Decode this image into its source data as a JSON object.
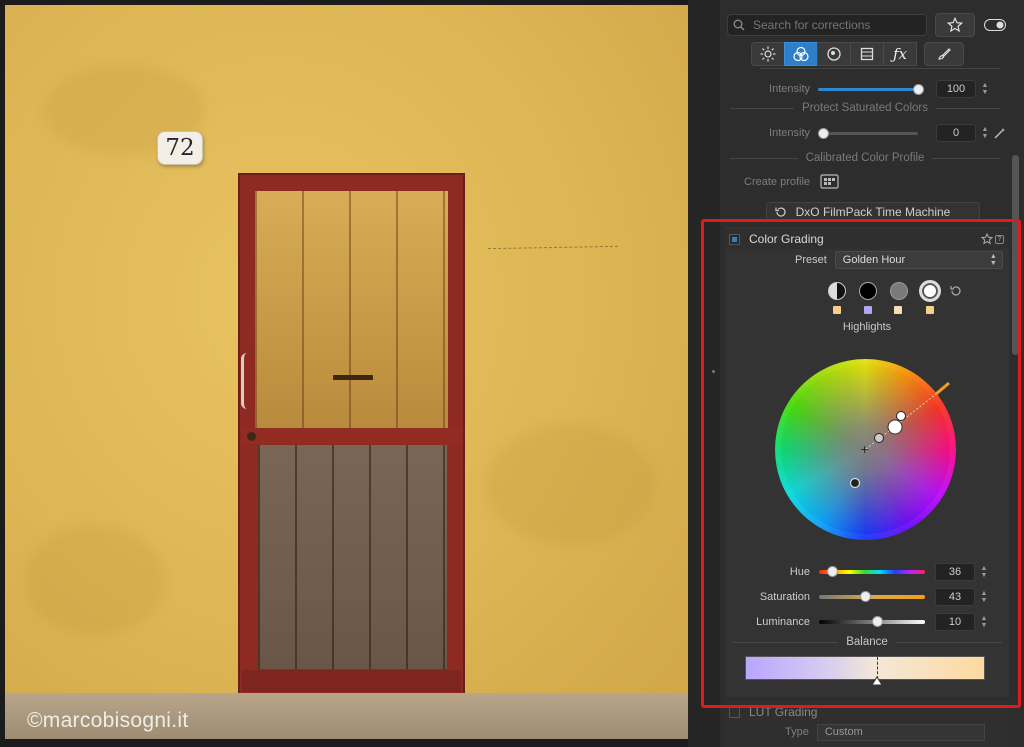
{
  "photo": {
    "house_number": "72",
    "watermark": "©marcobisogni.it"
  },
  "toolbar": {
    "search_placeholder": "Search for corrections",
    "tabs": [
      "light",
      "color",
      "detail",
      "geometry",
      "effects",
      "local"
    ]
  },
  "rendering": {
    "intensity_label": "Intensity",
    "intensity_value": "100",
    "intensity_level_percent": 100
  },
  "protect_saturated": {
    "title": "Protect Saturated Colors",
    "intensity_label": "Intensity",
    "intensity_value": "0",
    "intensity_level_percent": 0
  },
  "calibrated_profile": {
    "title": "Calibrated Color Profile",
    "create_label": "Create profile"
  },
  "filmpack": {
    "label": "DxO FilmPack Time Machine"
  },
  "color_grading": {
    "title": "Color Grading",
    "preset_label": "Preset",
    "preset_value": "Golden Hour",
    "tone_label": "Highlights",
    "tone_swatches": [
      "#f5d089",
      "#b3a6f2",
      "#f7e0b0",
      "#f5d089"
    ],
    "hue_label": "Hue",
    "hue_value": "36",
    "hue_level_percent": 12,
    "saturation_label": "Saturation",
    "saturation_value": "43",
    "saturation_level_percent": 43,
    "luminance_label": "Luminance",
    "luminance_value": "10",
    "luminance_level_percent": 55,
    "balance_label": "Balance",
    "balance_level_percent": 55
  },
  "lut_grading": {
    "title": "LUT Grading",
    "type_label": "Type",
    "type_value": "Custom"
  },
  "colors": {
    "accent": "#2e7fc8",
    "highlight_box": "#e01b1b"
  }
}
